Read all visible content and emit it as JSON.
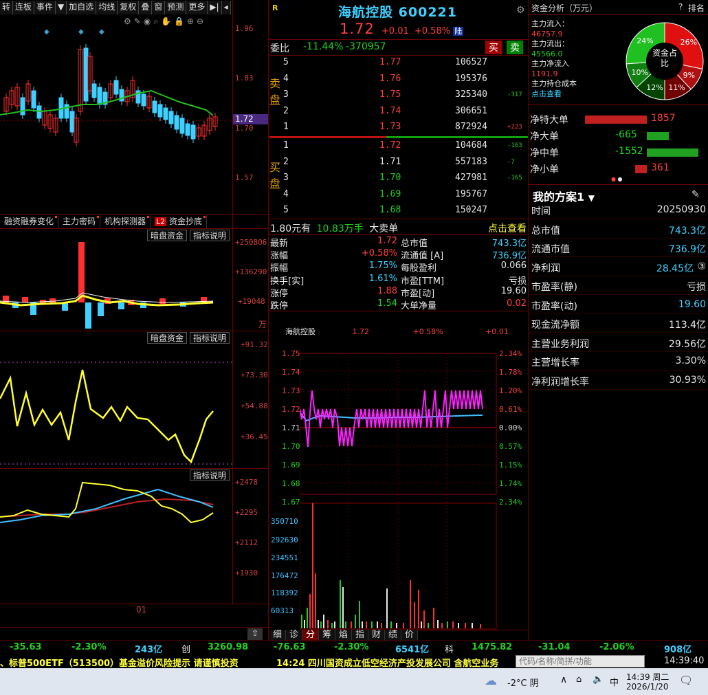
{
  "toolbar": {
    "buttons": [
      "转",
      "连板",
      "事件",
      "加自选",
      "均线",
      "复权",
      "叠",
      "窗",
      "预测",
      "更多"
    ]
  },
  "kline": {
    "price_labels": [
      "1.96",
      "1.83",
      "1.70",
      "1.57"
    ],
    "current_price_tag": "1.72"
  },
  "indicator_tabs": [
    "融资融券变化",
    "主力密码",
    "机构探测器",
    "资金抄底"
  ],
  "indicator_tab_badge": "L2",
  "panel1": {
    "btn1": "暗盘资金",
    "btn2": "指标说明",
    "labels": [
      "+250806",
      "+136290",
      "+19048"
    ],
    "unit": "万"
  },
  "panel2": {
    "btn1": "暗盘资金",
    "btn2": "指标说明",
    "labels": [
      "+91.32",
      "+73.30",
      "+54.88",
      "+36.45"
    ]
  },
  "panel3": {
    "btn2": "指标说明",
    "labels": [
      "+2478",
      "+2295",
      "+2112",
      "+1930"
    ],
    "date_label": "01"
  },
  "quote": {
    "r_badge": "R",
    "name": "海航控股",
    "code": "600221",
    "price": "1.72",
    "change": "+0.01",
    "change_pct": "+0.58%",
    "market_tag": "陆",
    "weibi_label": "委比",
    "weibi_pct": "-11.44%",
    "weibi_val": "-370957",
    "buy_btn": "买",
    "sell_btn": "卖",
    "sell_label": "卖盘",
    "buy_label": "买盘",
    "sells": [
      {
        "lvl": "5",
        "price": "1.77",
        "vol": "106527",
        "delta": ""
      },
      {
        "lvl": "4",
        "price": "1.76",
        "vol": "195376",
        "delta": ""
      },
      {
        "lvl": "3",
        "price": "1.75",
        "vol": "325340",
        "delta": "-317"
      },
      {
        "lvl": "2",
        "price": "1.74",
        "vol": "306651",
        "delta": ""
      },
      {
        "lvl": "1",
        "price": "1.73",
        "vol": "872924",
        "delta": "+223"
      }
    ],
    "buys": [
      {
        "lvl": "1",
        "price": "1.72",
        "vol": "104684",
        "delta": "-163"
      },
      {
        "lvl": "2",
        "price": "1.71",
        "vol": "557183",
        "delta": "-7"
      },
      {
        "lvl": "3",
        "price": "1.70",
        "vol": "427981",
        "delta": "-165"
      },
      {
        "lvl": "4",
        "price": "1.69",
        "vol": "195767",
        "delta": ""
      },
      {
        "lvl": "5",
        "price": "1.68",
        "vol": "150247",
        "delta": ""
      }
    ],
    "bigorder": {
      "price": "1.80元有",
      "qty": "10.83万手",
      "label": "大卖单",
      "link": "点击查看"
    },
    "stats": [
      {
        "l1": "最新",
        "v1": "1.72",
        "l2": "总市值",
        "v2": "743.3亿"
      },
      {
        "l1": "涨幅",
        "v1": "+0.58%",
        "l2": "流通值 [A]",
        "v2": "736.9亿"
      },
      {
        "l1": "振幅",
        "v1": "1.75%",
        "l2": "每股盈利",
        "v2": "0.066"
      },
      {
        "l1": "换手[实]",
        "v1": "1.61%",
        "l2": "市盈[TTM]",
        "v2": "亏损"
      },
      {
        "l1": "涨停",
        "v1": "1.88",
        "l2": "市盈[动]",
        "v2": "19.60"
      },
      {
        "l1": "跌停",
        "v1": "1.54",
        "l2": "大单净量",
        "v2": "0.02"
      }
    ]
  },
  "intraday": {
    "header_name": "海航控股",
    "header_price": "1.72",
    "header_pct": "+0.58%",
    "header_chg": "+0.01",
    "price_ticks": [
      "1.75",
      "1.74",
      "1.73",
      "1.72",
      "1.71",
      "1.70",
      "1.69",
      "1.68",
      "1.67"
    ],
    "pct_ticks": [
      "2.34%",
      "1.78%",
      "1.20%",
      "0.61%",
      "0.00%",
      "0.57%",
      "1.15%",
      "1.74%",
      "2.34%"
    ],
    "vol_ticks": [
      "350710",
      "292630",
      "234551",
      "176472",
      "118392",
      "60313"
    ],
    "tabs": [
      "细",
      "诊",
      "分",
      "筹",
      "焰",
      "指",
      "财",
      "绩",
      "价"
    ],
    "active_tab": "分"
  },
  "fund": {
    "title": "资金分析（万元）",
    "help": "?",
    "rank": "排名",
    "inflow_label": "主力流入：",
    "inflow": "46757.9",
    "outflow_label": "主力流出：",
    "outflow": "45566.0",
    "net_label": "主力净流入",
    "net": "1191.9",
    "cost_label": "主力持仓成本",
    "cost_link": "点击查看",
    "donut_center": "资金占比",
    "donut": [
      {
        "label": "26%",
        "value": 26,
        "color": "#e01010"
      },
      {
        "label": "9%",
        "value": 9,
        "color": "#b01010"
      },
      {
        "label": "11%",
        "value": 11,
        "color": "#700000"
      },
      {
        "label": "12%",
        "value": 12,
        "color": "#004400"
      },
      {
        "label": "10%",
        "value": 10,
        "color": "#108010"
      },
      {
        "label": "24%",
        "value": 24,
        "color": "#20c020"
      }
    ],
    "nets": [
      {
        "label": "净特大单",
        "value": "1857",
        "dir": 1,
        "mag": 1857
      },
      {
        "label": "净大单",
        "value": "-665",
        "dir": -1,
        "mag": 665
      },
      {
        "label": "净中单",
        "value": "-1552",
        "dir": -1,
        "mag": 1552
      },
      {
        "label": "净小单",
        "value": "361",
        "dir": 1,
        "mag": 361
      }
    ]
  },
  "plan": {
    "title": "我的方案1",
    "rows": [
      {
        "k": "时间",
        "v": "20250930"
      },
      {
        "k": "总市值",
        "v": "743.3亿"
      },
      {
        "k": "流通市值",
        "v": "736.9亿"
      },
      {
        "k": "净利润",
        "v": "28.45亿"
      },
      {
        "k": "市盈率(静)",
        "v": "亏损"
      },
      {
        "k": "市盈率(动)",
        "v": "19.60"
      },
      {
        "k": "现金流净额",
        "v": "113.4亿"
      },
      {
        "k": "主营业务利润",
        "v": "29.56亿"
      },
      {
        "k": "主营增长率",
        "v": "3.30%"
      },
      {
        "k": "净利润增长率",
        "v": "30.93%"
      }
    ],
    "net_profit_badge": "③"
  },
  "index_bar": {
    "a1": "-35.63",
    "a2": "-2.30%",
    "a3": "243亿",
    "a4": "创",
    "a5": "3260.98",
    "b1": "-76.63",
    "b2": "-2.30%",
    "b3": "6541亿",
    "b4": "科",
    "b5": "1475.82",
    "c1": "-31.04",
    "c2": "-2.06%",
    "c3": "908亿"
  },
  "ticker": {
    "left": "、标普500ETF（513500）基金溢价风险提示 请谨慎投资",
    "mid": "14:24 四川国资成立低空经济产投发展公司 含航空业务",
    "search_placeholder": "代码/名称/简拼/功能",
    "clock": "14:39:40"
  },
  "taskbar": {
    "weather": "-2°C 阴",
    "ime": "中",
    "time": "14:39 周二",
    "date": "2026/1/20"
  }
}
